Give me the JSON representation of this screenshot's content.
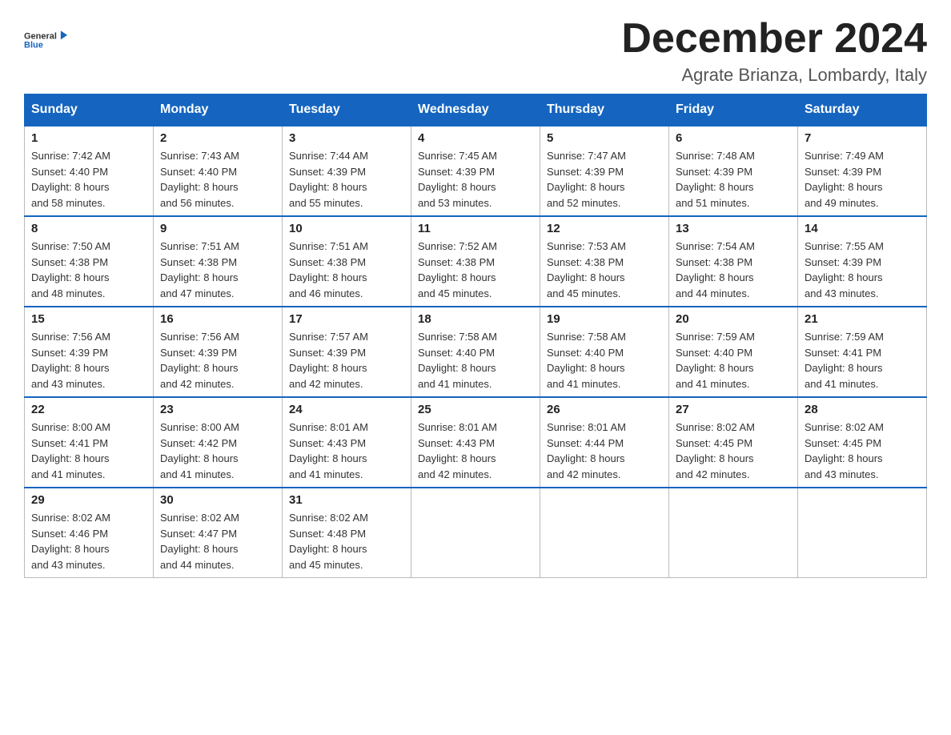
{
  "header": {
    "logo_general": "General",
    "logo_blue": "Blue",
    "month_title": "December 2024",
    "location": "Agrate Brianza, Lombardy, Italy"
  },
  "days_of_week": [
    "Sunday",
    "Monday",
    "Tuesday",
    "Wednesday",
    "Thursday",
    "Friday",
    "Saturday"
  ],
  "weeks": [
    [
      {
        "day": "1",
        "sunrise": "7:42 AM",
        "sunset": "4:40 PM",
        "daylight": "8 hours and 58 minutes."
      },
      {
        "day": "2",
        "sunrise": "7:43 AM",
        "sunset": "4:40 PM",
        "daylight": "8 hours and 56 minutes."
      },
      {
        "day": "3",
        "sunrise": "7:44 AM",
        "sunset": "4:39 PM",
        "daylight": "8 hours and 55 minutes."
      },
      {
        "day": "4",
        "sunrise": "7:45 AM",
        "sunset": "4:39 PM",
        "daylight": "8 hours and 53 minutes."
      },
      {
        "day": "5",
        "sunrise": "7:47 AM",
        "sunset": "4:39 PM",
        "daylight": "8 hours and 52 minutes."
      },
      {
        "day": "6",
        "sunrise": "7:48 AM",
        "sunset": "4:39 PM",
        "daylight": "8 hours and 51 minutes."
      },
      {
        "day": "7",
        "sunrise": "7:49 AM",
        "sunset": "4:39 PM",
        "daylight": "8 hours and 49 minutes."
      }
    ],
    [
      {
        "day": "8",
        "sunrise": "7:50 AM",
        "sunset": "4:38 PM",
        "daylight": "8 hours and 48 minutes."
      },
      {
        "day": "9",
        "sunrise": "7:51 AM",
        "sunset": "4:38 PM",
        "daylight": "8 hours and 47 minutes."
      },
      {
        "day": "10",
        "sunrise": "7:51 AM",
        "sunset": "4:38 PM",
        "daylight": "8 hours and 46 minutes."
      },
      {
        "day": "11",
        "sunrise": "7:52 AM",
        "sunset": "4:38 PM",
        "daylight": "8 hours and 45 minutes."
      },
      {
        "day": "12",
        "sunrise": "7:53 AM",
        "sunset": "4:38 PM",
        "daylight": "8 hours and 45 minutes."
      },
      {
        "day": "13",
        "sunrise": "7:54 AM",
        "sunset": "4:38 PM",
        "daylight": "8 hours and 44 minutes."
      },
      {
        "day": "14",
        "sunrise": "7:55 AM",
        "sunset": "4:39 PM",
        "daylight": "8 hours and 43 minutes."
      }
    ],
    [
      {
        "day": "15",
        "sunrise": "7:56 AM",
        "sunset": "4:39 PM",
        "daylight": "8 hours and 43 minutes."
      },
      {
        "day": "16",
        "sunrise": "7:56 AM",
        "sunset": "4:39 PM",
        "daylight": "8 hours and 42 minutes."
      },
      {
        "day": "17",
        "sunrise": "7:57 AM",
        "sunset": "4:39 PM",
        "daylight": "8 hours and 42 minutes."
      },
      {
        "day": "18",
        "sunrise": "7:58 AM",
        "sunset": "4:40 PM",
        "daylight": "8 hours and 41 minutes."
      },
      {
        "day": "19",
        "sunrise": "7:58 AM",
        "sunset": "4:40 PM",
        "daylight": "8 hours and 41 minutes."
      },
      {
        "day": "20",
        "sunrise": "7:59 AM",
        "sunset": "4:40 PM",
        "daylight": "8 hours and 41 minutes."
      },
      {
        "day": "21",
        "sunrise": "7:59 AM",
        "sunset": "4:41 PM",
        "daylight": "8 hours and 41 minutes."
      }
    ],
    [
      {
        "day": "22",
        "sunrise": "8:00 AM",
        "sunset": "4:41 PM",
        "daylight": "8 hours and 41 minutes."
      },
      {
        "day": "23",
        "sunrise": "8:00 AM",
        "sunset": "4:42 PM",
        "daylight": "8 hours and 41 minutes."
      },
      {
        "day": "24",
        "sunrise": "8:01 AM",
        "sunset": "4:43 PM",
        "daylight": "8 hours and 41 minutes."
      },
      {
        "day": "25",
        "sunrise": "8:01 AM",
        "sunset": "4:43 PM",
        "daylight": "8 hours and 42 minutes."
      },
      {
        "day": "26",
        "sunrise": "8:01 AM",
        "sunset": "4:44 PM",
        "daylight": "8 hours and 42 minutes."
      },
      {
        "day": "27",
        "sunrise": "8:02 AM",
        "sunset": "4:45 PM",
        "daylight": "8 hours and 42 minutes."
      },
      {
        "day": "28",
        "sunrise": "8:02 AM",
        "sunset": "4:45 PM",
        "daylight": "8 hours and 43 minutes."
      }
    ],
    [
      {
        "day": "29",
        "sunrise": "8:02 AM",
        "sunset": "4:46 PM",
        "daylight": "8 hours and 43 minutes."
      },
      {
        "day": "30",
        "sunrise": "8:02 AM",
        "sunset": "4:47 PM",
        "daylight": "8 hours and 44 minutes."
      },
      {
        "day": "31",
        "sunrise": "8:02 AM",
        "sunset": "4:48 PM",
        "daylight": "8 hours and 45 minutes."
      },
      null,
      null,
      null,
      null
    ]
  ],
  "labels": {
    "sunrise_prefix": "Sunrise: ",
    "sunset_prefix": "Sunset: ",
    "daylight_prefix": "Daylight: "
  }
}
